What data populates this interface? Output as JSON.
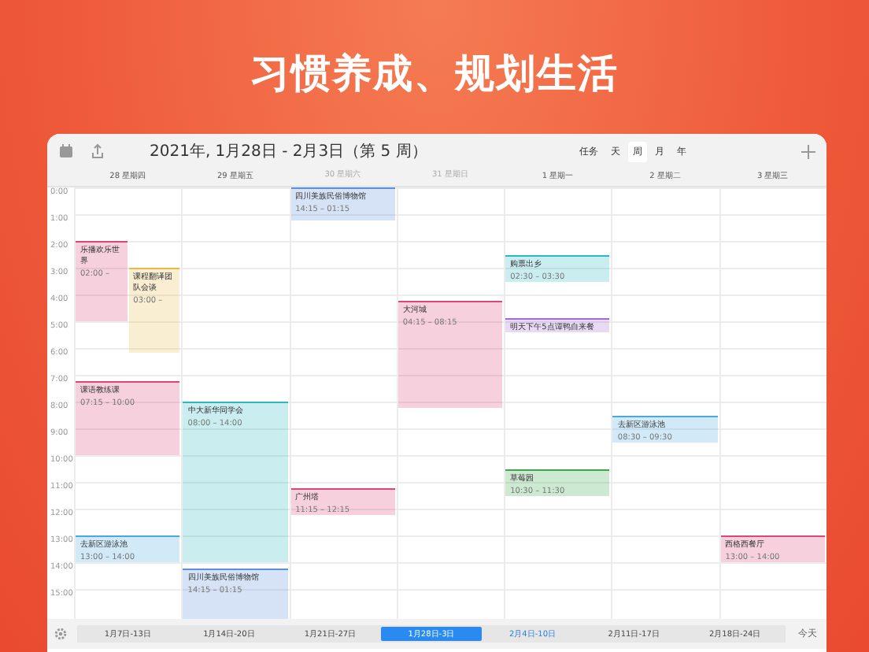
{
  "headline": "习惯养成、规划生活",
  "toolbar": {
    "title": "2021年, 1月28日 - 2月3日（第 5 周）",
    "tabs": [
      {
        "label": "任务",
        "selected": false
      },
      {
        "label": "天",
        "selected": false
      },
      {
        "label": "周",
        "selected": true
      },
      {
        "label": "月",
        "selected": false
      },
      {
        "label": "年",
        "selected": false
      }
    ]
  },
  "days": [
    {
      "label": "28 星期四",
      "weekend": false
    },
    {
      "label": "29 星期五",
      "weekend": false
    },
    {
      "label": "30 星期六",
      "weekend": true
    },
    {
      "label": "31 星期日",
      "weekend": true
    },
    {
      "label": "1 星期一",
      "weekend": false
    },
    {
      "label": "2 星期二",
      "weekend": false
    },
    {
      "label": "3 星期三",
      "weekend": false
    }
  ],
  "hours": [
    "0:00",
    "1:00",
    "2:00",
    "3:00",
    "4:00",
    "5:00",
    "6:00",
    "7:00",
    "8:00",
    "9:00",
    "10:00",
    "11:00",
    "12:00",
    "13:00",
    "14:00",
    "15:00"
  ],
  "events": [
    {
      "title": "四川美族民俗博物馆",
      "time": "14:15 – 01:15",
      "color": "#5b8fe0"
    },
    {
      "title": "乐播欢乐世界",
      "time": "02:00 –",
      "color": "#e0457a"
    },
    {
      "title": "课程翻译团队会谈",
      "time": "03:00 –",
      "color": "#e8b84a"
    },
    {
      "title": "大河城",
      "time": "04:15 – 08:15",
      "color": "#e0457a"
    },
    {
      "title": "购票出乡",
      "time": "02:30 – 03:30",
      "color": "#2ab8c4"
    },
    {
      "title": "明天下午5点谭鸭自来餐",
      "color": "#a46ad8"
    },
    {
      "title": "课语教练课",
      "time": "07:15 – 10:00",
      "color": "#e0457a"
    },
    {
      "title": "中大新华同学会",
      "time": "08:00 – 14:00",
      "color": "#2ab8c4"
    },
    {
      "title": "去新区游泳池",
      "time": "08:30 – 09:30",
      "color": "#4aa8e0"
    },
    {
      "title": "草莓园",
      "time": "10:30 – 11:30",
      "color": "#3aa84a"
    },
    {
      "title": "广州塔",
      "time": "11:15 – 12:15",
      "color": "#e0457a"
    },
    {
      "title": "去新区游泳池",
      "time": "13:00 – 14:00",
      "color": "#4aa8e0"
    },
    {
      "title": "西格西餐厅",
      "time": "13:00 – 14:00",
      "color": "#e0457a"
    },
    {
      "title": "四川美族民俗博物馆",
      "time": "14:15 – 01:15",
      "color": "#5b8fe0"
    }
  ],
  "weeks": [
    {
      "label": "1月7日-13日",
      "selected": false,
      "current": false
    },
    {
      "label": "1月14日-20日",
      "selected": false,
      "current": false
    },
    {
      "label": "1月21日-27日",
      "selected": false,
      "current": false
    },
    {
      "label": "1月28日-3日",
      "selected": true,
      "current": false
    },
    {
      "label": "2月4日-10日",
      "selected": false,
      "current": true
    },
    {
      "label": "2月11日-17日",
      "selected": false,
      "current": false
    },
    {
      "label": "2月18日-24日",
      "selected": false,
      "current": false
    }
  ],
  "today_button": "今天"
}
